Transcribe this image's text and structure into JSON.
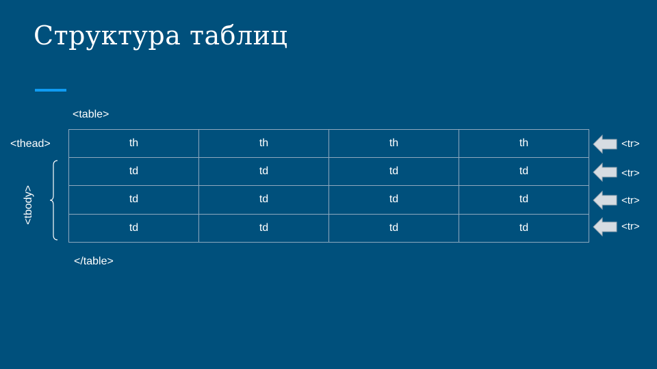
{
  "title": "Структура таблиц",
  "labels": {
    "table_open": "<table>",
    "table_close": "</table>",
    "thead": "<thead>",
    "tbody": "<tbody>",
    "tr": "<tr>"
  },
  "table": {
    "header_row": [
      "th",
      "th",
      "th",
      "th"
    ],
    "body_rows": [
      [
        "td",
        "td",
        "td",
        "td"
      ],
      [
        "td",
        "td",
        "td",
        "td"
      ],
      [
        "td",
        "td",
        "td",
        "td"
      ]
    ]
  },
  "colors": {
    "background": "#00507c",
    "accent": "#0f9bf2",
    "grid": "#8fa9bf",
    "arrow_fill": "#d6dce2",
    "text": "#ffffff"
  }
}
